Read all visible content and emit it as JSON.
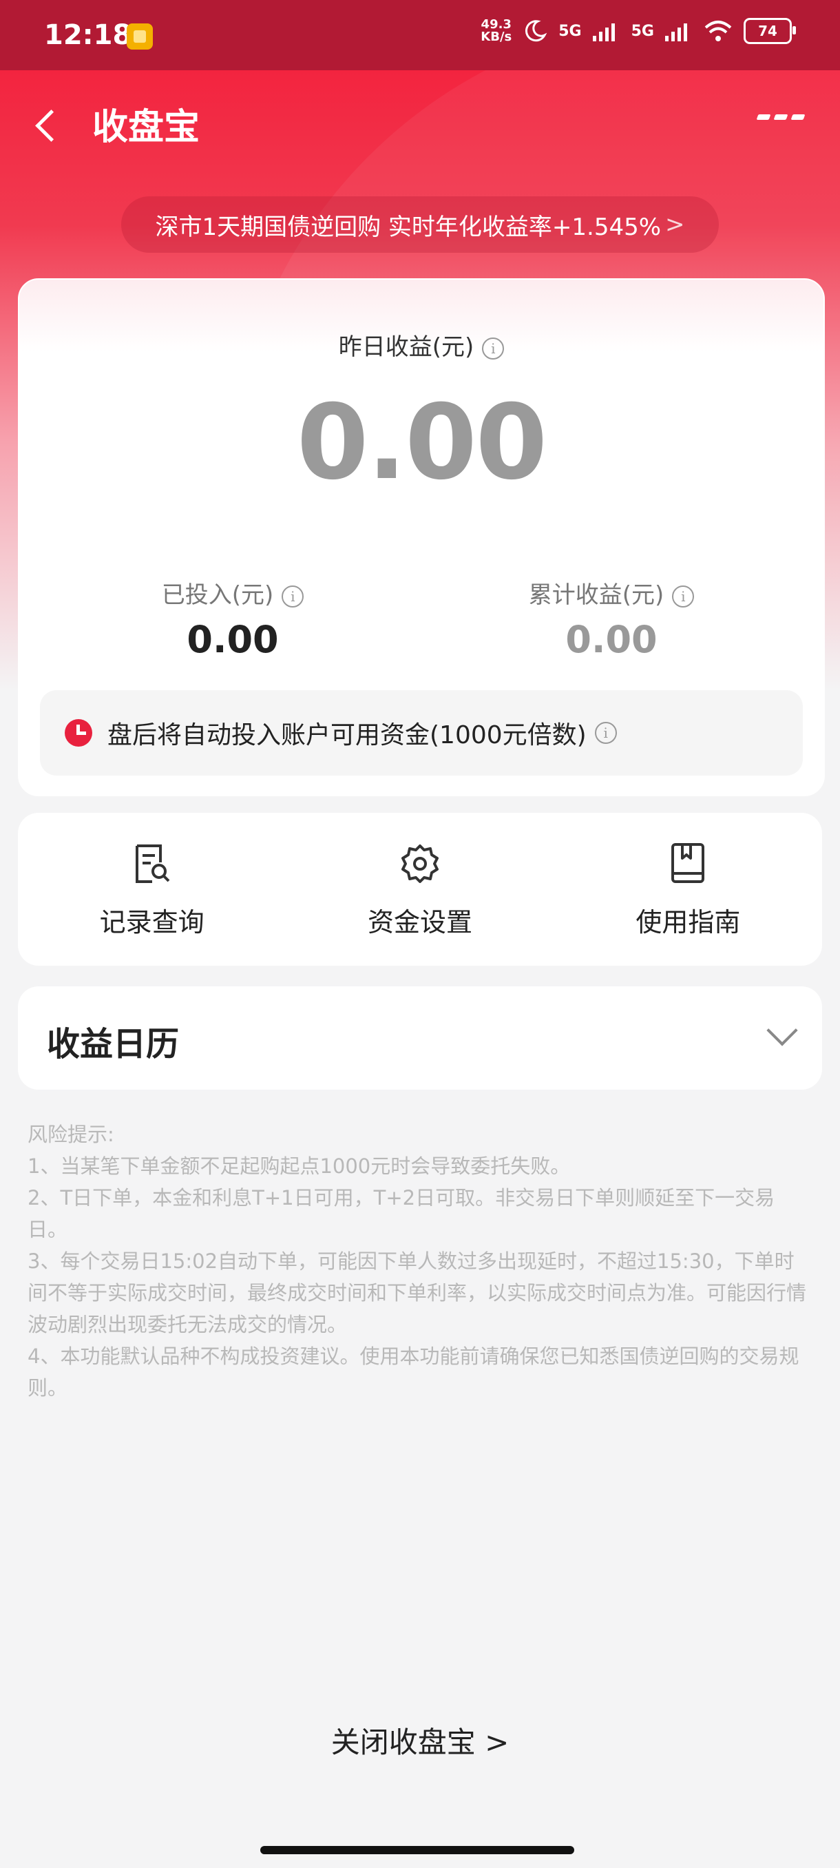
{
  "status_bar": {
    "time": "12:18",
    "net_speed_value": "49.3",
    "net_speed_unit": "KB/s",
    "signal_1": "5G",
    "signal_2": "5G",
    "battery": "74"
  },
  "header": {
    "title": "收盘宝"
  },
  "rate_banner": {
    "text": "深市1天期国债逆回购 实时年化收益率+1.545%",
    "arrow": ">"
  },
  "earnings": {
    "yesterday_label": "昨日收益(元)",
    "yesterday_value": "0.00",
    "invested_label": "已投入(元)",
    "invested_value": "0.00",
    "cumulative_label": "累计收益(元)",
    "cumulative_value": "0.00",
    "info_glyph": "i"
  },
  "notice": {
    "text": "盘后将自动投入账户可用资金(1000元倍数)"
  },
  "actions": [
    {
      "label": "记录查询",
      "icon": "record-search-icon"
    },
    {
      "label": "资金设置",
      "icon": "gear-icon"
    },
    {
      "label": "使用指南",
      "icon": "book-icon"
    }
  ],
  "calendar": {
    "title": "收益日历"
  },
  "risk": {
    "title": "风险提示:",
    "items": [
      "1、当某笔下单金额不足起购起点1000元时会导致委托失败。",
      "2、T日下单，本金和利息T+1日可用，T+2日可取。非交易日下单则顺延至下一交易日。",
      "3、每个交易日15:02自动下单，可能因下单人数过多出现延时，不超过15:30，下单时间不等于实际成交时间，最终成交时间和下单利率，以实际成交时间点为准。可能因行情波动剧烈出现委托无法成交的情况。",
      "4、本功能默认品种不构成投资建议。使用本功能前请确保您已知悉国债逆回购的交易规则。"
    ]
  },
  "footer": {
    "close_label": "关闭收盘宝 >"
  },
  "colors": {
    "brand_red": "#f3243f",
    "status_bar": "#b21a34"
  }
}
